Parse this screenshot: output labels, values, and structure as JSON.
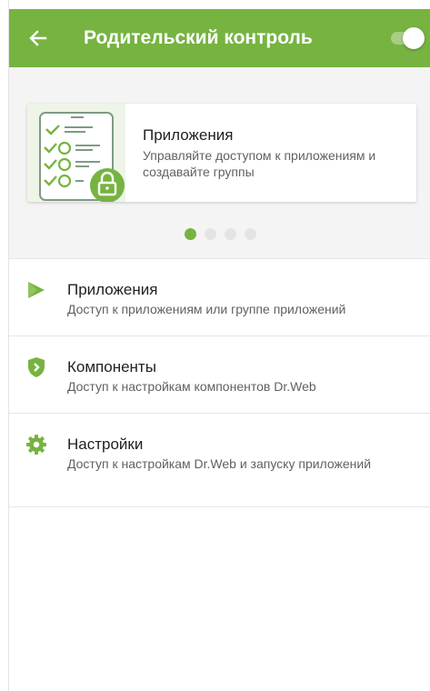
{
  "appbar": {
    "back_icon": "arrow-left-icon",
    "title": "Родительский контроль",
    "toggle_state": "on"
  },
  "carousel": {
    "card": {
      "illustration": "checklist-lock-icon",
      "title": "Приложения",
      "description": "Управляйте доступом к приложениям и создавайте группы"
    },
    "page_count": 4,
    "active_page": 1
  },
  "menu": {
    "items": [
      {
        "icon": "apps-play-icon",
        "title": "Приложения",
        "description": "Доступ к приложениям или группе приложений"
      },
      {
        "icon": "shield-icon",
        "title": "Компоненты",
        "description": "Доступ к настройкам компонентов Dr.Web"
      },
      {
        "icon": "gear-icon",
        "title": "Настройки",
        "description": "Доступ к настройкам Dr.Web и запуску приложений"
      }
    ]
  },
  "colors": {
    "accent": "#77b341",
    "appbar_text": "#ffffff",
    "carousel_bg": "#f4f4f4"
  }
}
